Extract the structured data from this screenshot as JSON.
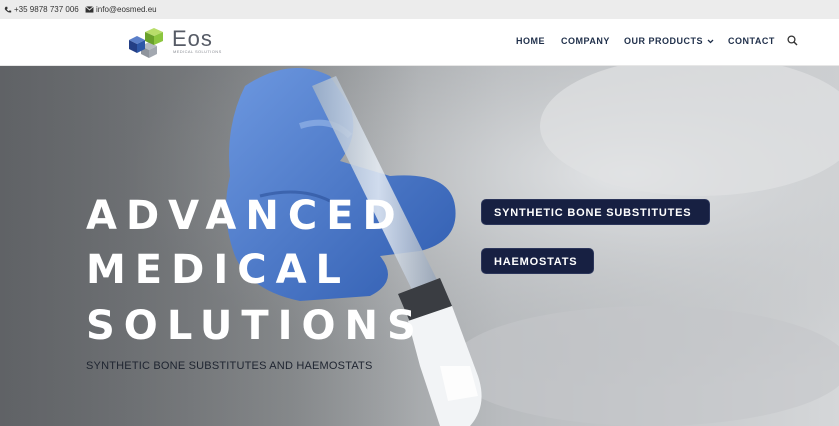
{
  "topbar": {
    "phone": "+35 9878 737 006",
    "email": "info@eosmed.eu"
  },
  "header": {
    "logo_word": "Eos",
    "logo_sub": "MEDICAL SOLUTIONS",
    "nav": [
      {
        "label": "HOME"
      },
      {
        "label": "COMPANY"
      },
      {
        "label": "OUR PRODUCTS"
      },
      {
        "label": "CONTACT"
      }
    ]
  },
  "hero": {
    "headline_1": "ADVANCED",
    "headline_2": "MEDICAL",
    "headline_3": "SOLUTIONS",
    "subline": "SYNTHETIC BONE SUBSTITUTES AND HAEMOSTATS",
    "buttons": [
      {
        "label": "SYNTHETIC BONE SUBSTITUTES"
      },
      {
        "label": "HAEMOSTATS"
      }
    ]
  },
  "colors": {
    "topbar_bg": "#ececec",
    "nav_text": "#1f2f4a",
    "button_bg": "#172042",
    "logo_green": "#8cc63f",
    "logo_blue": "#2e57a7",
    "glove_blue": "#4a78c9"
  }
}
